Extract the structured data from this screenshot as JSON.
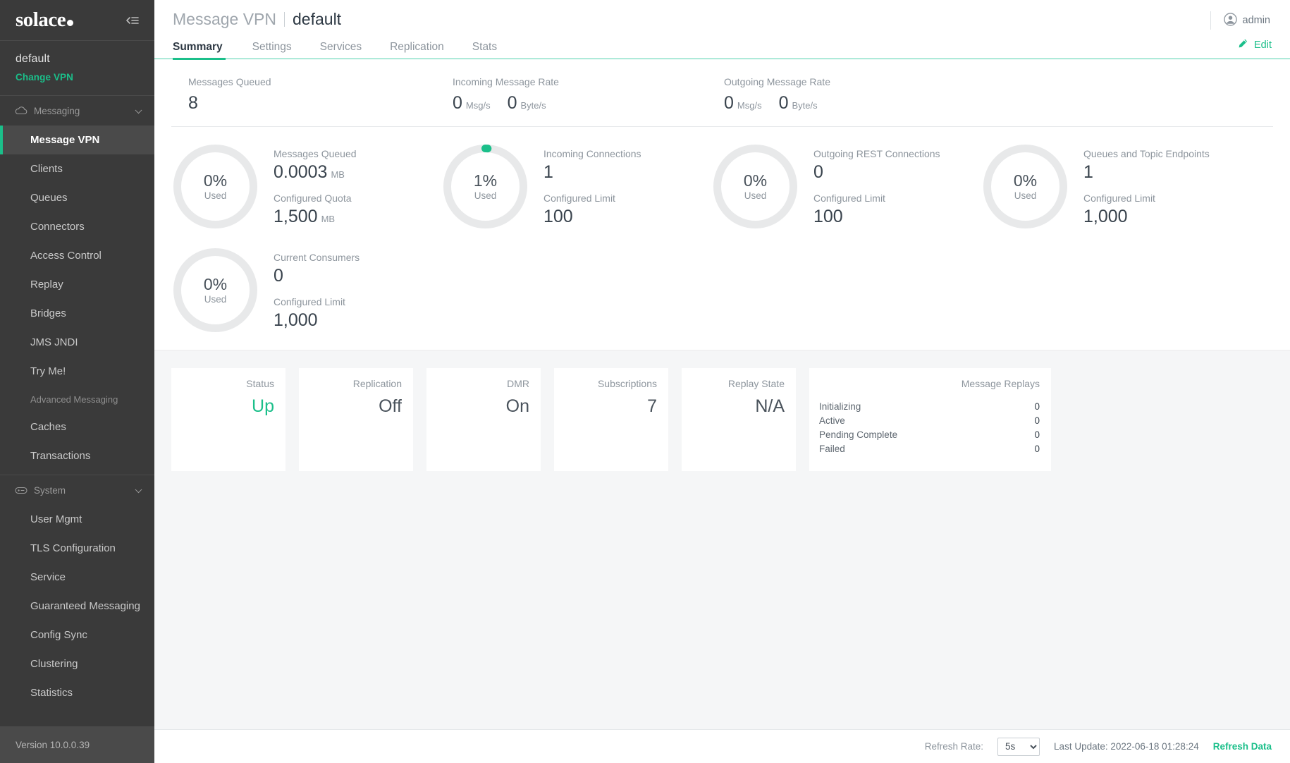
{
  "brand": {
    "name": "solace",
    "collapse_icon": "collapse-sidebar-icon"
  },
  "vpn": {
    "name": "default",
    "change_link": "Change VPN"
  },
  "sidebar": {
    "groups": [
      {
        "label": "Messaging",
        "icon": "cloud-icon",
        "items": [
          {
            "label": "Message VPN",
            "active": true
          },
          {
            "label": "Clients",
            "active": false
          },
          {
            "label": "Queues",
            "active": false
          },
          {
            "label": "Connectors",
            "active": false
          },
          {
            "label": "Access Control",
            "active": false
          },
          {
            "label": "Replay",
            "active": false
          },
          {
            "label": "Bridges",
            "active": false
          },
          {
            "label": "JMS JNDI",
            "active": false
          },
          {
            "label": "Try Me!",
            "active": false
          },
          {
            "label": "Advanced Messaging",
            "subheader": true
          },
          {
            "label": "Caches",
            "active": false
          },
          {
            "label": "Transactions",
            "active": false
          }
        ]
      },
      {
        "label": "System",
        "icon": "system-chip-icon",
        "items": [
          {
            "label": "User Mgmt",
            "active": false
          },
          {
            "label": "TLS Configuration",
            "active": false
          },
          {
            "label": "Service",
            "active": false
          },
          {
            "label": "Guaranteed Messaging",
            "active": false
          },
          {
            "label": "Config Sync",
            "active": false
          },
          {
            "label": "Clustering",
            "active": false
          },
          {
            "label": "Statistics",
            "active": false
          }
        ]
      }
    ],
    "version": "Version 10.0.0.39"
  },
  "header": {
    "title_prefix": "Message VPN",
    "title_name": "default",
    "user": "admin",
    "user_icon": "account-circle-icon",
    "edit_label": "Edit",
    "edit_icon": "pencil-icon"
  },
  "tabs": [
    {
      "label": "Summary",
      "active": true
    },
    {
      "label": "Settings",
      "active": false
    },
    {
      "label": "Services",
      "active": false
    },
    {
      "label": "Replication",
      "active": false
    },
    {
      "label": "Stats",
      "active": false
    }
  ],
  "kpis": [
    {
      "label": "Messages Queued",
      "values": [
        {
          "num": "8",
          "unit": ""
        }
      ]
    },
    {
      "label": "Incoming Message Rate",
      "values": [
        {
          "num": "0",
          "unit": "Msg/s"
        },
        {
          "num": "0",
          "unit": "Byte/s"
        }
      ]
    },
    {
      "label": "Outgoing Message Rate",
      "values": [
        {
          "num": "0",
          "unit": "Msg/s"
        },
        {
          "num": "0",
          "unit": "Byte/s"
        }
      ]
    }
  ],
  "gauges": [
    {
      "percent": 0,
      "percent_label": "0%",
      "used_label": "Used",
      "primary_label": "Messages Queued",
      "primary_value": "0.0003",
      "primary_unit": "MB",
      "secondary_label": "Configured Quota",
      "secondary_value": "1,500",
      "secondary_unit": "MB"
    },
    {
      "percent": 1,
      "percent_label": "1%",
      "used_label": "Used",
      "primary_label": "Incoming Connections",
      "primary_value": "1",
      "primary_unit": "",
      "secondary_label": "Configured Limit",
      "secondary_value": "100",
      "secondary_unit": ""
    },
    {
      "percent": 0,
      "percent_label": "0%",
      "used_label": "Used",
      "primary_label": "Outgoing REST Connections",
      "primary_value": "0",
      "primary_unit": "",
      "secondary_label": "Configured Limit",
      "secondary_value": "100",
      "secondary_unit": ""
    },
    {
      "percent": 0,
      "percent_label": "0%",
      "used_label": "Used",
      "primary_label": "Queues and Topic Endpoints",
      "primary_value": "1",
      "primary_unit": "",
      "secondary_label": "Configured Limit",
      "secondary_value": "1,000",
      "secondary_unit": ""
    },
    {
      "percent": 0,
      "percent_label": "0%",
      "used_label": "Used",
      "primary_label": "Current Consumers",
      "primary_value": "0",
      "primary_unit": "",
      "secondary_label": "Configured Limit",
      "secondary_value": "1,000",
      "secondary_unit": ""
    }
  ],
  "tiles": [
    {
      "label": "Status",
      "value": "Up",
      "accent": true
    },
    {
      "label": "Replication",
      "value": "Off",
      "accent": false
    },
    {
      "label": "DMR",
      "value": "On",
      "accent": false
    },
    {
      "label": "Subscriptions",
      "value": "7",
      "accent": false
    },
    {
      "label": "Replay State",
      "value": "N/A",
      "accent": false
    }
  ],
  "message_replays": {
    "title": "Message Replays",
    "rows": [
      {
        "label": "Initializing",
        "value": "0"
      },
      {
        "label": "Active",
        "value": "0"
      },
      {
        "label": "Pending Complete",
        "value": "0"
      },
      {
        "label": "Failed",
        "value": "0"
      }
    ]
  },
  "footer": {
    "refresh_rate_label": "Refresh Rate:",
    "refresh_rate_value": "5s",
    "refresh_rate_options": [
      "5s"
    ],
    "last_update": "Last Update: 2022-06-18 01:28:24",
    "refresh_button": "Refresh Data"
  },
  "colors": {
    "accent": "#1bbf8a",
    "tab_underline": "#4fd1ab",
    "sidebar_bg": "#3a3a3a",
    "track": "#e8e9ea"
  }
}
